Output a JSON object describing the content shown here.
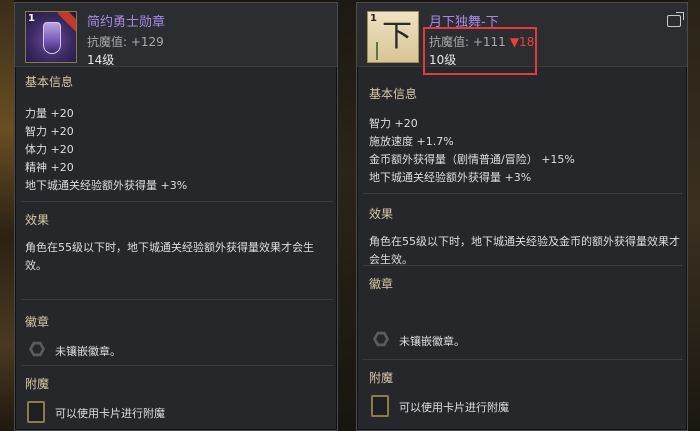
{
  "left": {
    "level_tag": "1",
    "name": "简约勇士勋章",
    "resist": "抗魔值: +129",
    "level": "14级",
    "basic_title": "基本信息",
    "stats": [
      "力量 +20",
      "智力 +20",
      "体力 +20",
      "精神 +20",
      "地下城通关经验额外获得量 +3%"
    ],
    "effect_title": "效果",
    "effect_desc": "角色在55级以下时，地下城通关经验额外获得量效果才会生效。",
    "emblem_title": "徽章",
    "emblem_text": "未镶嵌徽章。",
    "enchant_title": "附魔",
    "enchant_text": "可以使用卡片进行附魔"
  },
  "right": {
    "level_tag": "1",
    "name": "月下独舞-下",
    "resist": "抗魔值: +111",
    "resist_diff": "▼18",
    "level": "10级",
    "basic_title": "基本信息",
    "stats": [
      "智力 +20",
      "施放速度 +1.7%",
      "金币额外获得量（剧情普通/冒险） +15%",
      "地下城通关经验额外获得量 +3%"
    ],
    "effect_title": "效果",
    "effect_desc": "角色在55级以下时，地下城通关经验及金币的额外获得量效果才会生效。",
    "emblem_title": "徽章",
    "emblem_text": "未镶嵌徽章。",
    "enchant_title": "附魔",
    "enchant_text": "可以使用卡片进行附魔"
  },
  "colors": {
    "item_name": "#a88ae6",
    "resist_down": "#e84040",
    "highlight_box": "#e03c3c",
    "section_title": "#d8c9a4"
  },
  "icons": {
    "left_item": "medal-icon",
    "right_item": "scroll-icon",
    "emblem": "hexagon-icon",
    "enchant": "card-slot-icon",
    "export": "export-icon"
  }
}
